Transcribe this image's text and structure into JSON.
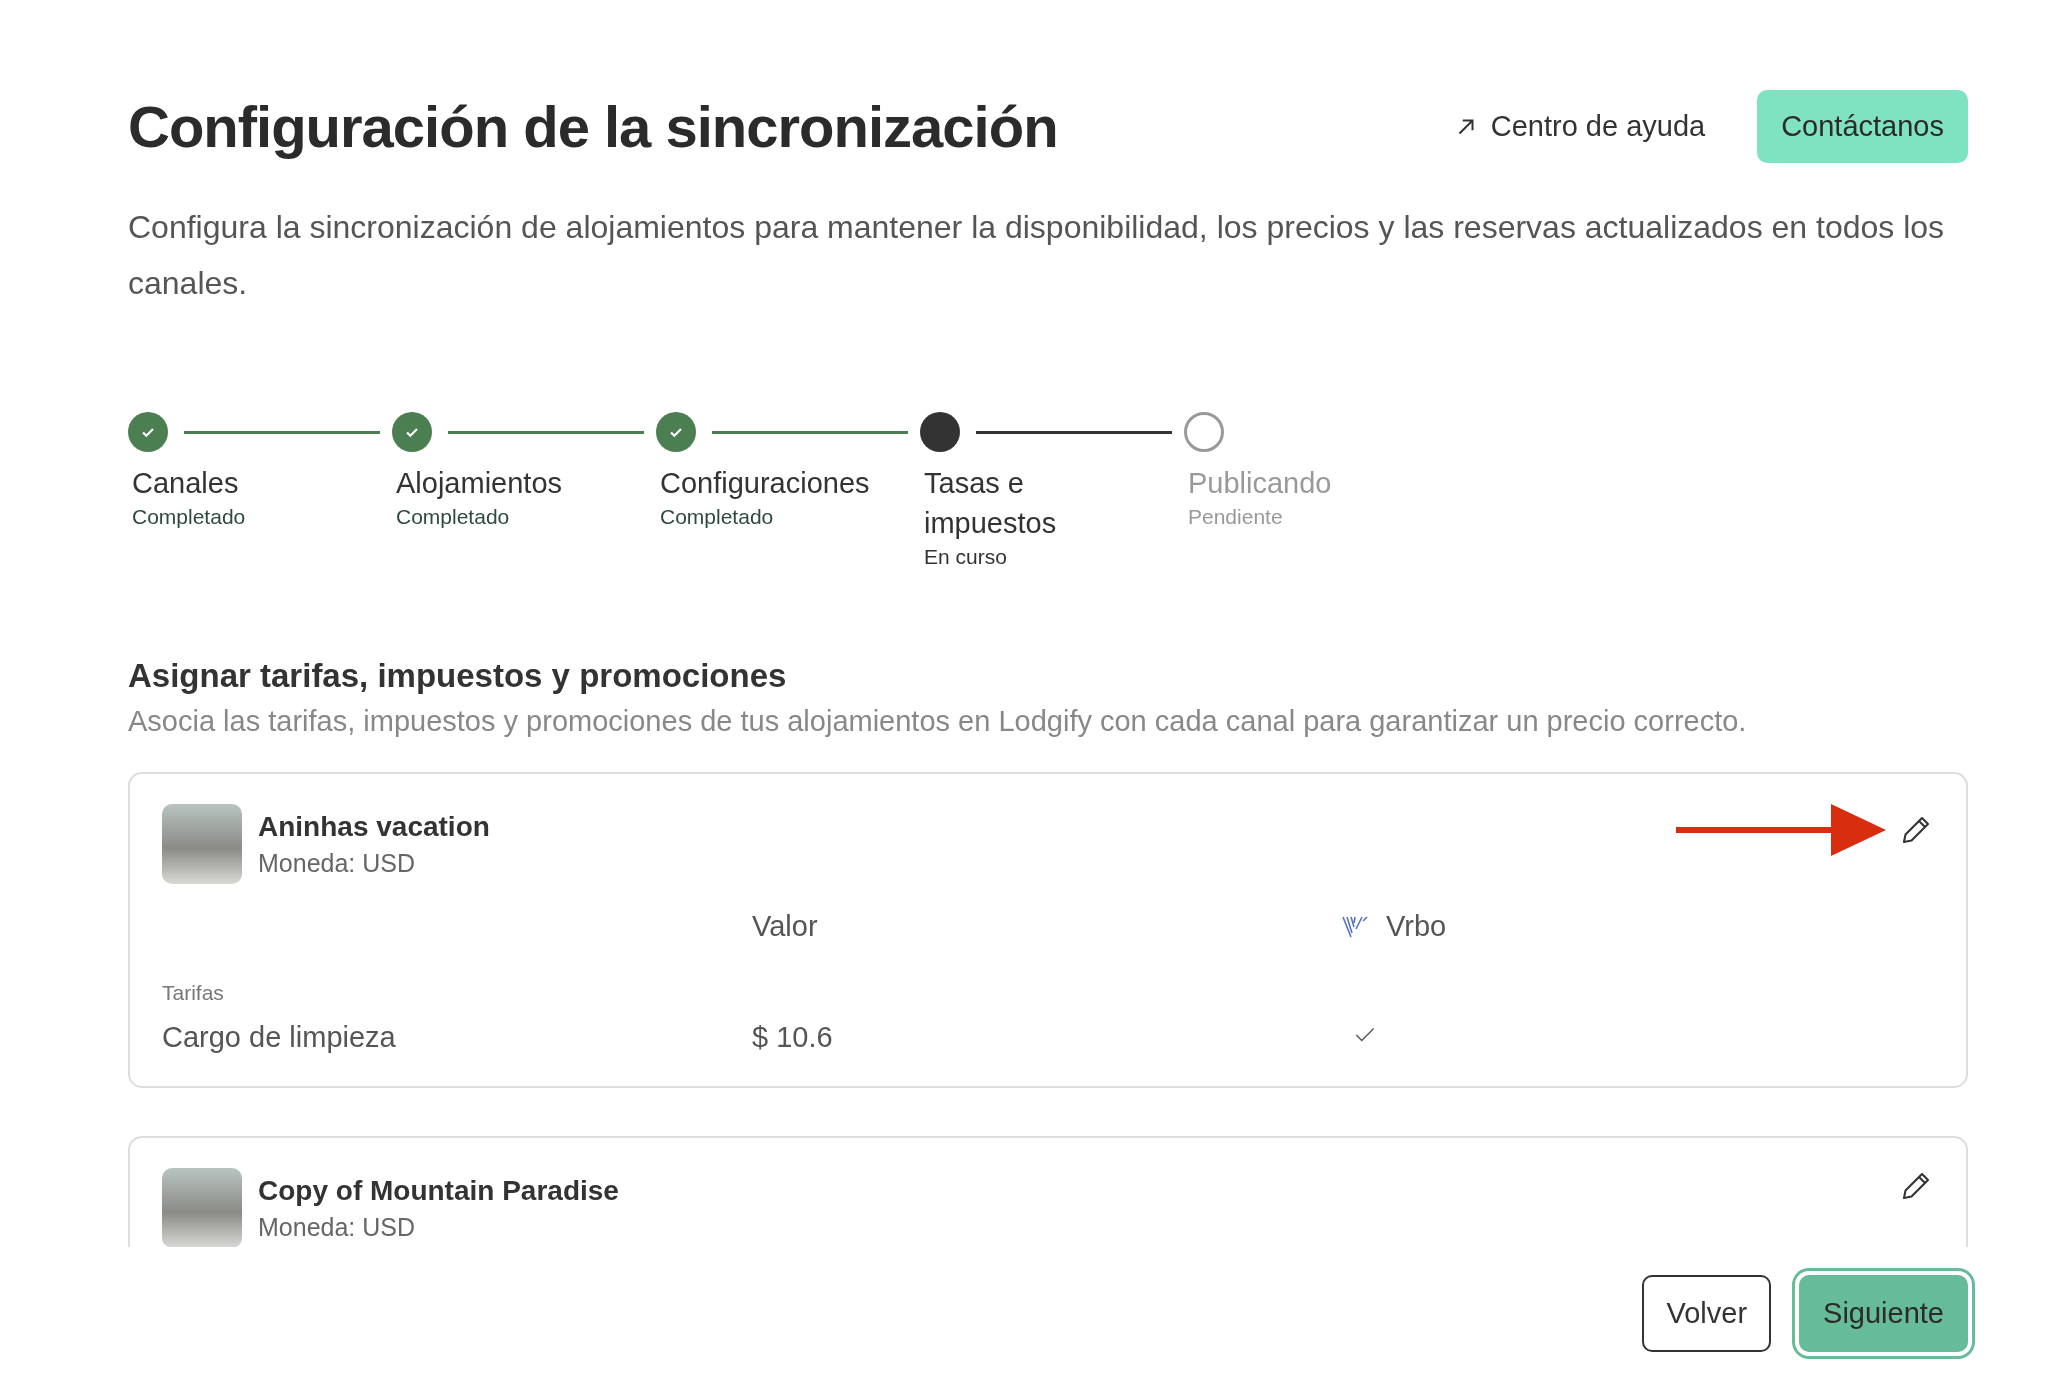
{
  "header": {
    "title": "Configuración de la sincronización",
    "help_link": "Centro de ayuda",
    "contact_button": "Contáctanos"
  },
  "description": "Configura la sincronización de alojamientos para mantener la disponibilidad, los precios y las reservas actualizados en todos los canales.",
  "steps": [
    {
      "label": "Canales",
      "status_text": "Completado",
      "kind": "done"
    },
    {
      "label": "Alojamientos",
      "status_text": "Completado",
      "kind": "done"
    },
    {
      "label": "Configuraciones",
      "status_text": "Completado",
      "kind": "done"
    },
    {
      "label": "Tasas e impuestos",
      "status_text": "En curso",
      "kind": "current"
    },
    {
      "label": "Publicando",
      "status_text": "Pendiente",
      "kind": "pending"
    }
  ],
  "section": {
    "title": "Asignar tarifas, impuestos y promociones",
    "subtitle": "Asocia las tarifas, impuestos y promociones de tus alojamientos en Lodgify con cada canal para garantizar un precio correcto."
  },
  "properties": [
    {
      "name": "Aninhas vacation",
      "currency": "Moneda: USD",
      "annotated": true,
      "table": {
        "columns": [
          "Valor",
          "Vrbo"
        ],
        "group": "Tarifas",
        "rows": [
          {
            "name": "Cargo de limpieza",
            "value": "$ 10.6",
            "vrbo_checked": true
          }
        ]
      }
    },
    {
      "name": "Copy of Mountain Paradise",
      "currency": "Moneda: USD",
      "annotated": false
    }
  ],
  "footer": {
    "back_button": "Volver",
    "next_button": "Siguiente"
  }
}
